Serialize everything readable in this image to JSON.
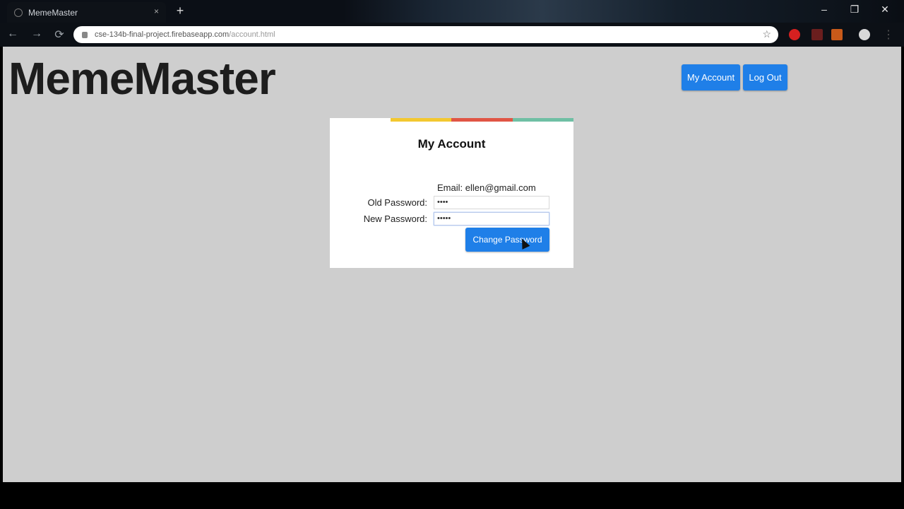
{
  "browser": {
    "tab_title": "MemeMaster",
    "tab_close": "×",
    "new_tab": "+",
    "url_main": "cse-134b-final-project.firebaseapp.com",
    "url_path": "/account.html",
    "window_controls": {
      "minimize": "–",
      "maximize": "❐",
      "close": "✕"
    }
  },
  "header": {
    "logo": "MemeMaster",
    "my_account_label": "My Account",
    "logout_label": "Log Out"
  },
  "account_card": {
    "title": "My Account",
    "email_label": "Email:",
    "email_value": "ellen@gmail.com",
    "old_password_label": "Old Password:",
    "old_password_value": "••••",
    "new_password_label": "New Password:",
    "new_password_value": "•••••",
    "change_password_label": "Change Password",
    "stripe_colors": [
      "#ffffff",
      "#f3c830",
      "#e05545",
      "#6fbfa4"
    ]
  },
  "colors": {
    "accent": "#1f7fe8",
    "page_bg": "#cecece"
  }
}
